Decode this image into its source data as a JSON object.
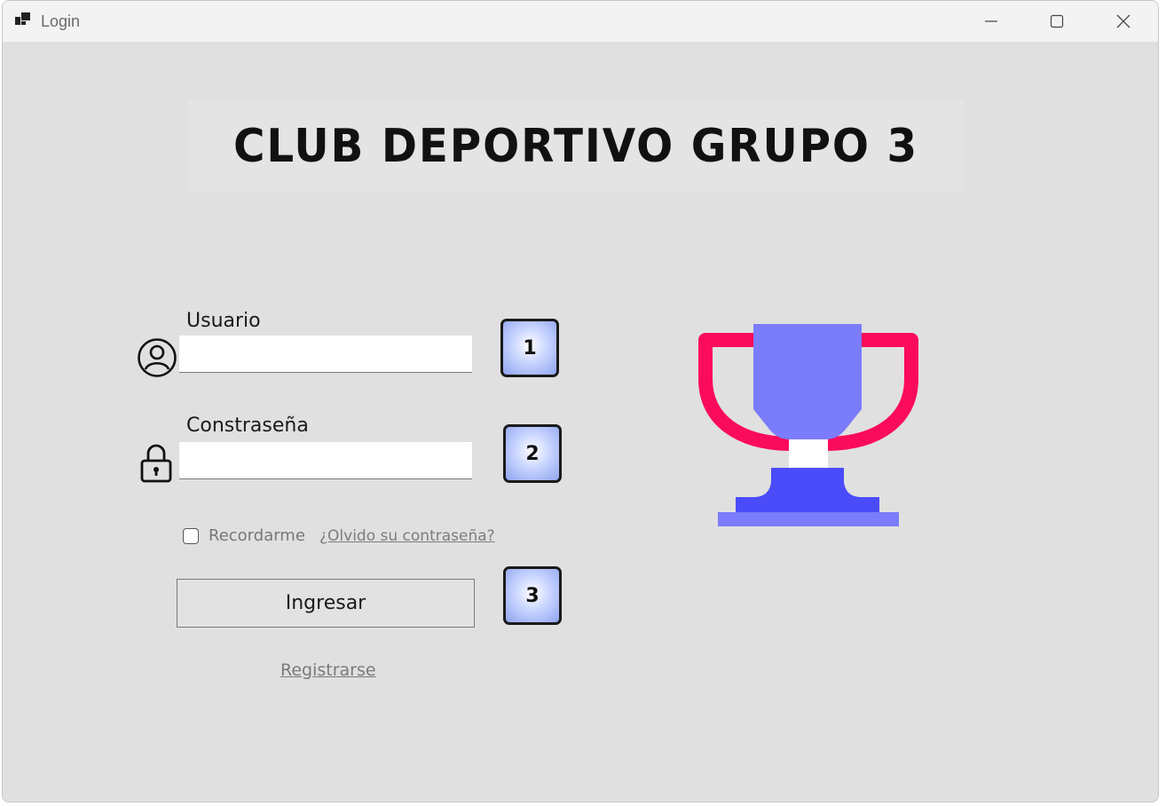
{
  "window": {
    "title": "Login",
    "icon": "app-window-icon",
    "controls": [
      "minimize-icon",
      "maximize-icon",
      "close-icon"
    ]
  },
  "banner": {
    "title": "CLUB DEPORTIVO GRUPO 3"
  },
  "form": {
    "username_label": "Usuario",
    "username_value": "",
    "password_label": "Constraseña",
    "password_value": "",
    "remember_label": "Recordarme",
    "remember_checked": false,
    "forgot_link": "¿Olvido su contraseña?",
    "submit_label": "Ingresar",
    "register_link": "Registrarse"
  },
  "badges": [
    "1",
    "2",
    "3"
  ],
  "icons": {
    "user": "user-circle-icon",
    "lock": "lock-icon",
    "trophy": "trophy-icon"
  },
  "colors": {
    "trophy_handles": "#fb0b5b",
    "trophy_cup": "#7b7cfb",
    "trophy_base": "#4a4cf9",
    "trophy_stem": "#ffffff",
    "background": "#e0e0e0"
  }
}
